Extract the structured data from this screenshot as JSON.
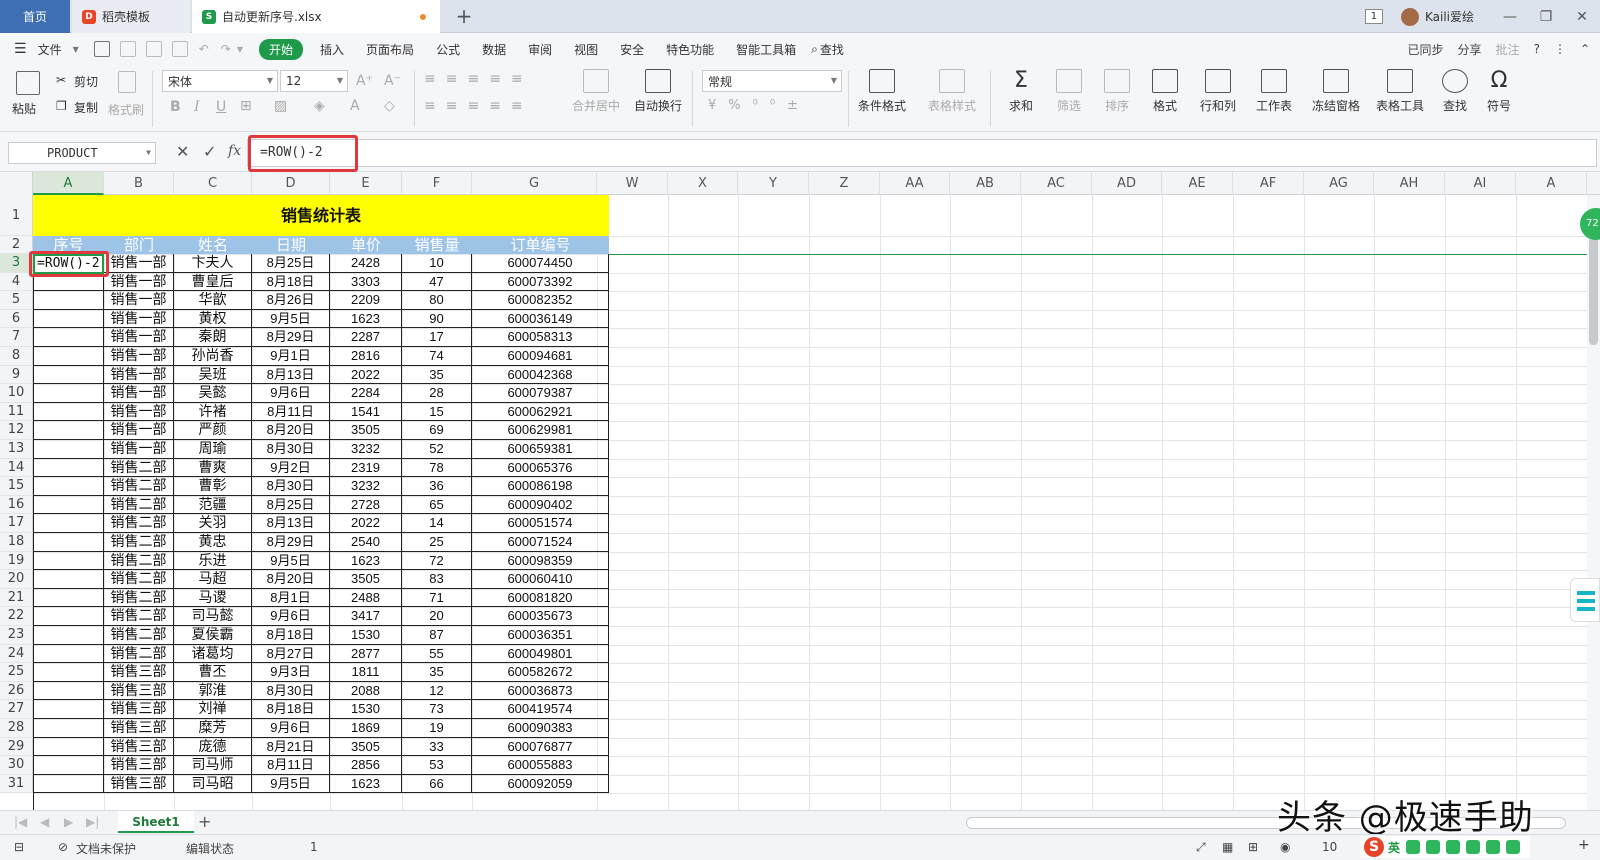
{
  "titlebar": {
    "tabs": [
      {
        "label": "首页"
      },
      {
        "label": "稻壳模板"
      },
      {
        "label": "自动更新序号.xlsx"
      }
    ],
    "window_count": "1",
    "user_name": "Kaili爱绘"
  },
  "menu": {
    "file_label": "文件",
    "items": [
      "开始",
      "插入",
      "页面布局",
      "公式",
      "数据",
      "审阅",
      "视图",
      "安全",
      "特色功能",
      "智能工具箱",
      "查找"
    ],
    "right": [
      "已同步",
      "分享",
      "批注",
      "?"
    ]
  },
  "ribbon": {
    "paste": "粘贴",
    "cut": "剪切",
    "copy": "复制",
    "format_painter": "格式刷",
    "font_name": "宋体",
    "font_size": "12",
    "merge_center": "合并居中",
    "wrap_text": "自动换行",
    "number_format": "常规",
    "buttons": [
      "条件格式",
      "表格样式",
      "求和",
      "筛选",
      "排序",
      "格式",
      "行和列",
      "工作表",
      "冻结窗格",
      "表格工具",
      "查找",
      "符号"
    ]
  },
  "formula_bar": {
    "name_box": "PRODUCT",
    "formula": "=ROW()-2",
    "fx": "fx"
  },
  "columns": [
    "A",
    "B",
    "C",
    "D",
    "E",
    "F",
    "G",
    "W",
    "X",
    "Y",
    "Z",
    "AA",
    "AB",
    "AC",
    "AD",
    "AE",
    "AF",
    "AG",
    "AH",
    "AI",
    "A"
  ],
  "rows": [
    "1",
    "2",
    "3",
    "4",
    "5",
    "6",
    "7",
    "8",
    "9",
    "10",
    "11",
    "12",
    "13",
    "14",
    "15",
    "16",
    "17",
    "18",
    "19",
    "20",
    "21",
    "22",
    "23",
    "24",
    "25",
    "26",
    "27",
    "28",
    "29",
    "30",
    "31"
  ],
  "sheet": {
    "title": "销售统计表",
    "headers": [
      "序号",
      "部门",
      "姓名",
      "日期",
      "单价",
      "销售量",
      "订单编号"
    ],
    "active_cell_value": "=ROW()-2",
    "data": [
      [
        "销售一部",
        "卞夫人",
        "8月25日",
        "2428",
        "10",
        "600074450"
      ],
      [
        "销售一部",
        "曹皇后",
        "8月18日",
        "3303",
        "47",
        "600073392"
      ],
      [
        "销售一部",
        "华歆",
        "8月26日",
        "2209",
        "80",
        "600082352"
      ],
      [
        "销售一部",
        "黄权",
        "9月5日",
        "1623",
        "90",
        "600036149"
      ],
      [
        "销售一部",
        "秦朗",
        "8月29日",
        "2287",
        "17",
        "600058313"
      ],
      [
        "销售一部",
        "孙尚香",
        "9月1日",
        "2816",
        "74",
        "600094681"
      ],
      [
        "销售一部",
        "吴班",
        "8月13日",
        "2022",
        "35",
        "600042368"
      ],
      [
        "销售一部",
        "吴懿",
        "9月6日",
        "2284",
        "28",
        "600079387"
      ],
      [
        "销售一部",
        "许褚",
        "8月11日",
        "1541",
        "15",
        "600062921"
      ],
      [
        "销售一部",
        "严颜",
        "8月20日",
        "3505",
        "69",
        "600629981"
      ],
      [
        "销售一部",
        "周瑜",
        "8月30日",
        "3232",
        "52",
        "600659381"
      ],
      [
        "销售二部",
        "曹爽",
        "9月2日",
        "2319",
        "78",
        "600065376"
      ],
      [
        "销售二部",
        "曹彰",
        "8月30日",
        "3232",
        "36",
        "600086198"
      ],
      [
        "销售二部",
        "范疆",
        "8月25日",
        "2728",
        "65",
        "600090402"
      ],
      [
        "销售二部",
        "关羽",
        "8月13日",
        "2022",
        "14",
        "600051574"
      ],
      [
        "销售二部",
        "黄忠",
        "8月29日",
        "2540",
        "25",
        "600071524"
      ],
      [
        "销售二部",
        "乐进",
        "9月5日",
        "1623",
        "72",
        "600098359"
      ],
      [
        "销售二部",
        "马超",
        "8月20日",
        "3505",
        "83",
        "600060410"
      ],
      [
        "销售二部",
        "马谡",
        "8月1日",
        "2488",
        "71",
        "600081820"
      ],
      [
        "销售二部",
        "司马懿",
        "9月6日",
        "3417",
        "20",
        "600035673"
      ],
      [
        "销售二部",
        "夏侯霸",
        "8月18日",
        "1530",
        "87",
        "600036351"
      ],
      [
        "销售二部",
        "诸葛均",
        "8月27日",
        "2877",
        "55",
        "600049801"
      ],
      [
        "销售三部",
        "曹丕",
        "9月3日",
        "1811",
        "35",
        "600582672"
      ],
      [
        "销售三部",
        "郭淮",
        "8月30日",
        "2088",
        "12",
        "600036873"
      ],
      [
        "销售三部",
        "刘禅",
        "8月18日",
        "1530",
        "73",
        "600419574"
      ],
      [
        "销售三部",
        "糜芳",
        "9月6日",
        "1869",
        "19",
        "600090383"
      ],
      [
        "销售三部",
        "庞德",
        "8月21日",
        "3505",
        "33",
        "600076877"
      ],
      [
        "销售三部",
        "司马师",
        "8月11日",
        "2856",
        "53",
        "600055883"
      ],
      [
        "销售三部",
        "司马昭",
        "9月5日",
        "1623",
        "66",
        "600092059"
      ]
    ]
  },
  "sheet_tab": "Sheet1",
  "status": {
    "protect": "文档未保护",
    "mode": "编辑状态",
    "value": "1",
    "zoom": "10",
    "badge": "72",
    "ime": "英"
  },
  "watermark": "头条 @极速手助",
  "colors": {
    "accent": "#1f9a4a",
    "title_fill": "#ffff00",
    "header_fill": "#9dc3e6",
    "highlight": "#e0393c"
  }
}
